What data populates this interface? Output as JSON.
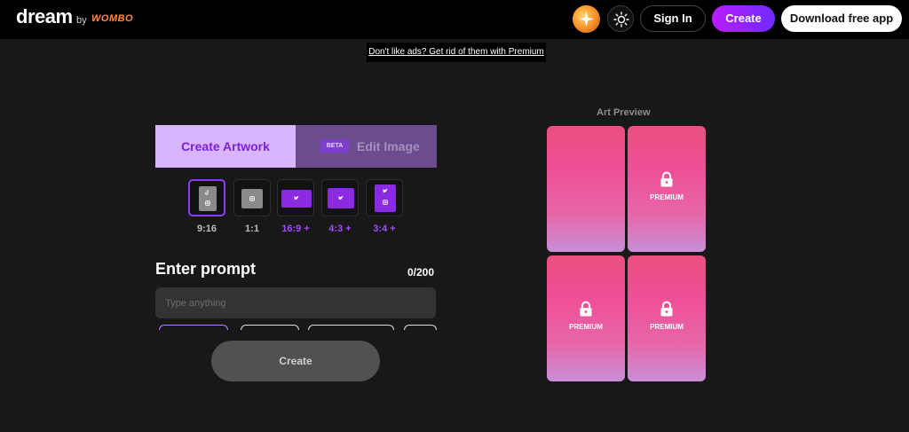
{
  "header": {
    "logo": "dream",
    "by": "by",
    "brand": "WOMBO",
    "sign_in": "Sign In",
    "create": "Create",
    "download": "Download free app"
  },
  "ads_banner": "Don't like ads? Get rid of them with Premium",
  "tabs": {
    "create_artwork": "Create Artwork",
    "beta": "BETA",
    "edit_image": "Edit Image"
  },
  "aspect_ratios": [
    {
      "label": "9:16",
      "selected": true
    },
    {
      "label": "1:1",
      "selected": false
    },
    {
      "label": "16:9 +",
      "premium": true
    },
    {
      "label": "4:3 +",
      "premium": true
    },
    {
      "label": "3:4 +",
      "premium": true
    }
  ],
  "prompt": {
    "title": "Enter prompt",
    "counter": "0/200",
    "placeholder": "Type anything",
    "value": ""
  },
  "create_button": "Create",
  "preview": {
    "title": "Art Preview",
    "premium_label": "PREMIUM"
  },
  "colors": {
    "accent": "#8a3cff",
    "create_gradient_start": "#b91cff",
    "create_gradient_end": "#6f2bff",
    "tab_active_bg": "#d9b4ff",
    "tab_inactive_bg": "#6c4b8e"
  }
}
